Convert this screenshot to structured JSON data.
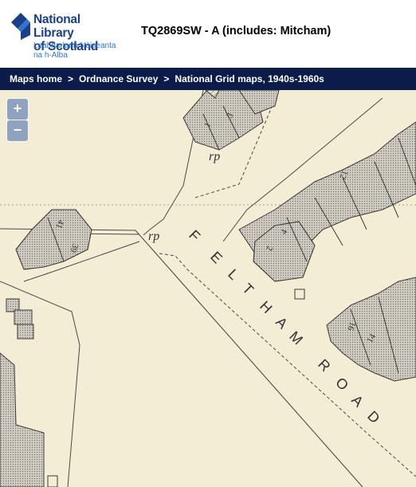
{
  "header": {
    "logo_line1": "National Library",
    "logo_line2": "of Scotland",
    "logo_gaelic1": "Leabharlann Nàiseanta",
    "logo_gaelic2": "na h-Alba",
    "title": "TQ2869SW - A (includes: Mitcham)"
  },
  "breadcrumb": {
    "items": [
      "Maps home",
      "Ordnance Survey",
      "National Grid maps, 1940s-1960s"
    ],
    "separator": ">"
  },
  "map_controls": {
    "zoom_in": "+",
    "zoom_out": "−"
  },
  "map": {
    "road_letters": [
      "F",
      "E",
      "L",
      "T",
      "H",
      "A",
      "M",
      "R",
      "O",
      "A",
      "D"
    ],
    "label_rp": "rp",
    "house_numbers": [
      "1",
      "3",
      "12",
      "2",
      "4",
      "39",
      "41",
      "16",
      "14"
    ]
  },
  "colors": {
    "brand_navy": "#1b3f8b",
    "brand_blue": "#2f77c9",
    "breadcrumb_bg": "#0b1c4a",
    "map_paper": "#f3edd6",
    "building_fill": "#c9c6bc"
  }
}
